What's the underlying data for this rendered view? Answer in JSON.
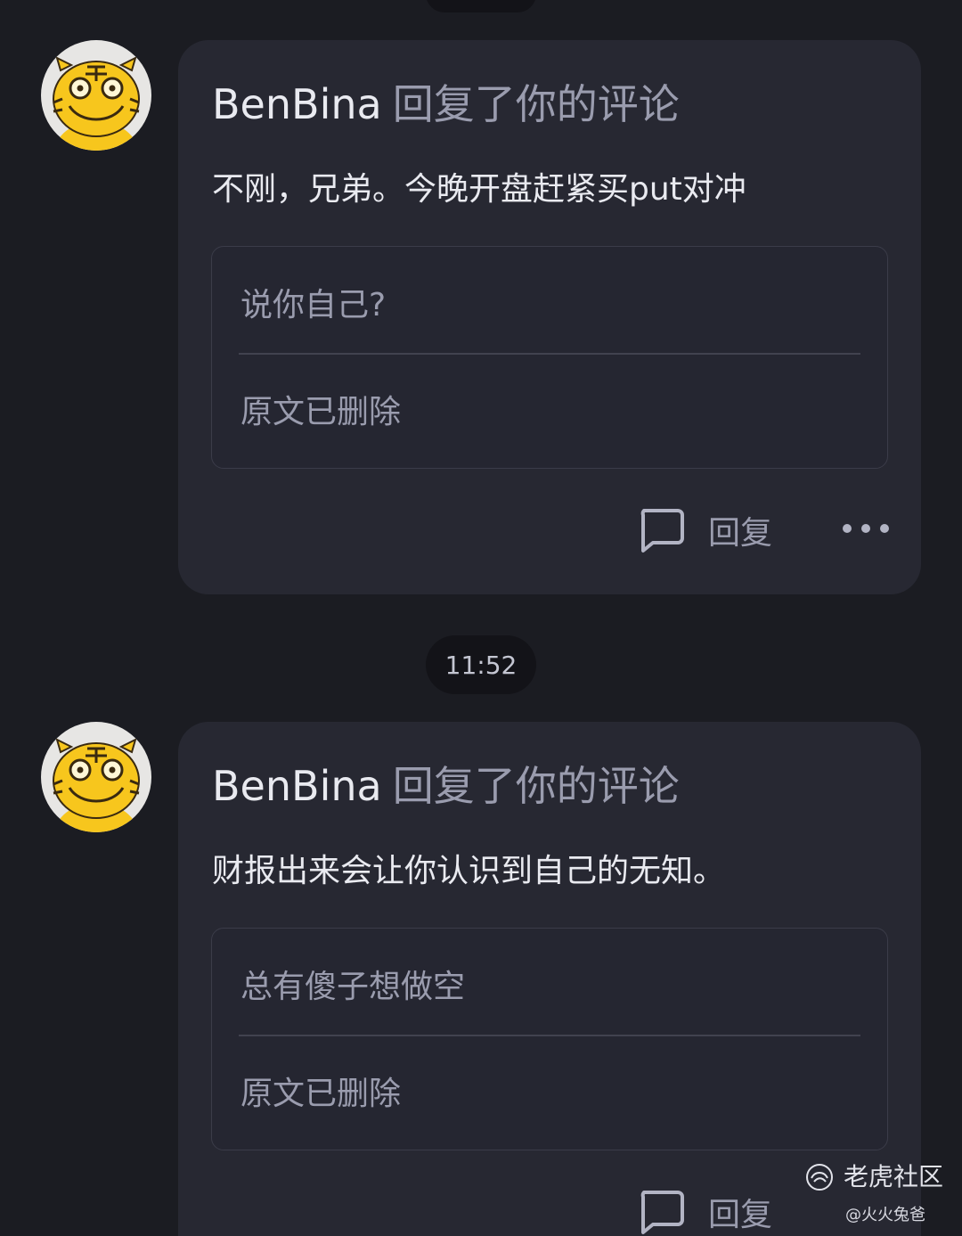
{
  "top_indicator": "",
  "timestamp": "11:52",
  "notifications": [
    {
      "avatar_icon": "tiger-avatar-icon",
      "user": "BenBina",
      "action": "回复了你的评论",
      "reply_text": "不刚，兄弟。今晚开盘赶紧买put对冲",
      "my_comment": "说你自己?",
      "original_post": "原文已删除",
      "reply_label": "回复",
      "more_icon": "more-horizontal-icon"
    },
    {
      "avatar_icon": "tiger-avatar-icon",
      "user": "BenBina",
      "action": "回复了你的评论",
      "reply_text": "财报出来会让你认识到自己的无知。",
      "my_comment": "总有傻子想做空",
      "original_post": "原文已删除",
      "reply_label": "回复"
    }
  ],
  "watermark": {
    "brand": "老虎社区",
    "user": "@火火兔爸"
  },
  "colors": {
    "background": "#1b1c22",
    "card": "#272832",
    "text_primary": "#e9eaf0",
    "text_secondary": "#9a9cae",
    "avatar_yellow": "#f7c61d"
  }
}
